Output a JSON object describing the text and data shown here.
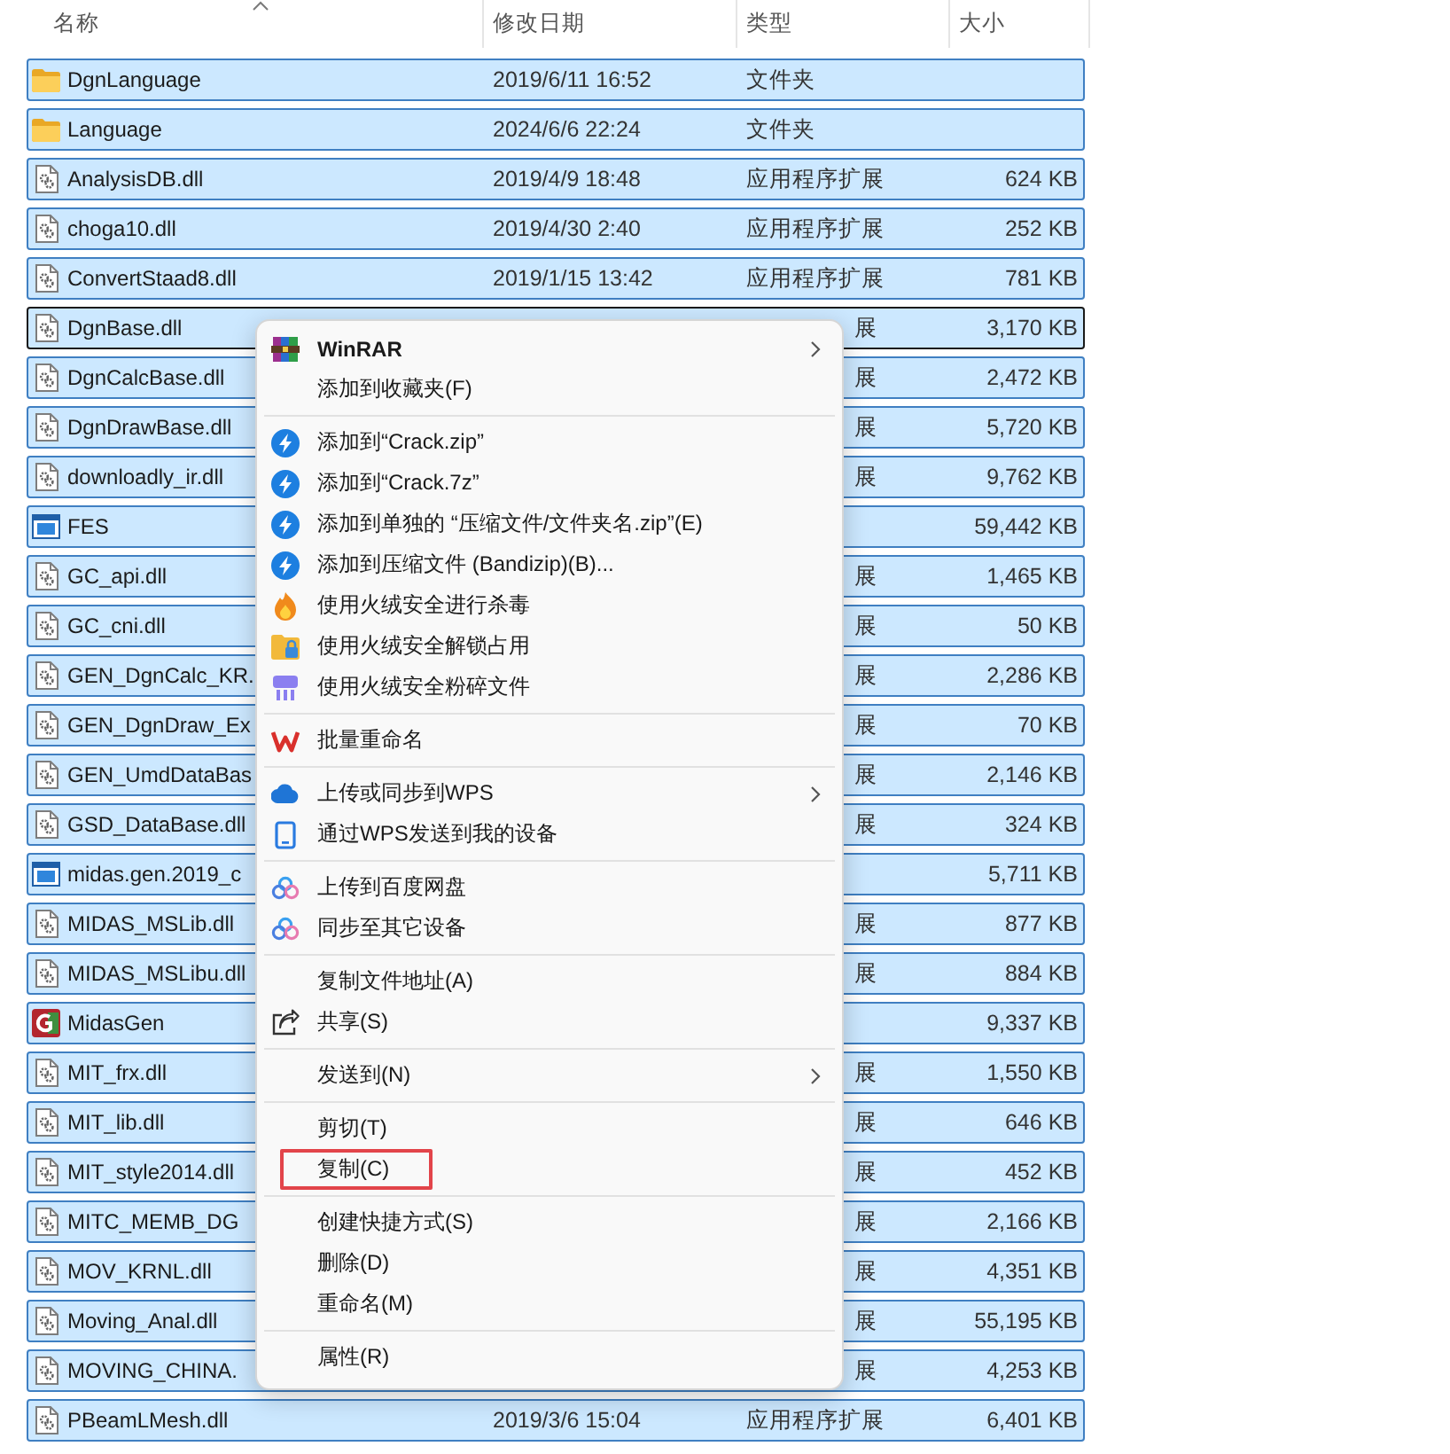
{
  "header": {
    "columns": [
      {
        "label": "名称",
        "sorted": true
      },
      {
        "label": "修改日期",
        "sorted": false
      },
      {
        "label": "类型",
        "sorted": false
      },
      {
        "label": "大小",
        "sorted": false
      }
    ]
  },
  "files": {
    "rows": [
      {
        "kind": "folder",
        "name": "DgnLanguage",
        "date": "2019/6/11 16:52",
        "type": "文件夹",
        "selected": true,
        "focused": false
      },
      {
        "kind": "folder",
        "name": "Language",
        "date": "2024/6/6 22:24",
        "type": "文件夹",
        "selected": true,
        "focused": false
      },
      {
        "kind": "library",
        "name": "AnalysisDB.dll",
        "date": "2019/4/9 18:48",
        "type": "应用程序扩展",
        "size": "624 KB",
        "selected": true,
        "focused": false
      },
      {
        "kind": "library",
        "name": "choga10.dll",
        "date": "2019/4/30 2:40",
        "type": "应用程序扩展",
        "size": "252 KB",
        "selected": true,
        "focused": false
      },
      {
        "kind": "library",
        "name": "ConvertStaad8.dll",
        "date": "2019/1/15 13:42",
        "type": "应用程序扩展",
        "size": "781 KB",
        "selected": true,
        "focused": false
      },
      {
        "kind": "library",
        "name": "DgnBase.dll",
        "type": "展",
        "size": "3,170 KB",
        "selected": true,
        "focused": true
      },
      {
        "kind": "library",
        "name": "DgnCalcBase.dll",
        "type": "展",
        "size": "2,472 KB",
        "selected": true,
        "focused": false
      },
      {
        "kind": "library",
        "name": "DgnDrawBase.dll",
        "type": "展",
        "size": "5,720 KB",
        "selected": true,
        "focused": false
      },
      {
        "kind": "library",
        "name": "downloadly_ir.dll",
        "type": "展",
        "size": "9,762 KB",
        "selected": true,
        "focused": false
      },
      {
        "kind": "program",
        "name": "FES",
        "size": "59,442 KB",
        "selected": true,
        "focused": false
      },
      {
        "kind": "library",
        "name": "GC_api.dll",
        "type": "展",
        "size": "1,465 KB",
        "selected": true,
        "focused": false
      },
      {
        "kind": "library",
        "name": "GC_cni.dll",
        "type": "展",
        "size": "50 KB",
        "selected": true,
        "focused": false
      },
      {
        "kind": "library",
        "name": "GEN_DgnCalc_KR.",
        "type": "展",
        "size": "2,286 KB",
        "selected": true,
        "focused": false
      },
      {
        "kind": "library",
        "name": "GEN_DgnDraw_Ex",
        "type": "展",
        "size": "70 KB",
        "selected": true,
        "focused": false
      },
      {
        "kind": "library",
        "name": "GEN_UmdDataBas",
        "type": "展",
        "size": "2,146 KB",
        "selected": true,
        "focused": false
      },
      {
        "kind": "library",
        "name": "GSD_DataBase.dll",
        "type": "展",
        "size": "324 KB",
        "selected": true,
        "focused": false
      },
      {
        "kind": "program",
        "name": "midas.gen.2019_c",
        "size": "5,711 KB",
        "selected": true,
        "focused": false
      },
      {
        "kind": "library",
        "name": "MIDAS_MSLib.dll",
        "type": "展",
        "size": "877 KB",
        "selected": true,
        "focused": false
      },
      {
        "kind": "library",
        "name": "MIDAS_MSLibu.dll",
        "type": "展",
        "size": "884 KB",
        "selected": true,
        "focused": false
      },
      {
        "kind": "app",
        "name": "MidasGen",
        "size": "9,337 KB",
        "selected": true,
        "focused": false
      },
      {
        "kind": "library",
        "name": "MIT_frx.dll",
        "type": "展",
        "size": "1,550 KB",
        "selected": true,
        "focused": false
      },
      {
        "kind": "library",
        "name": "MIT_lib.dll",
        "type": "展",
        "size": "646 KB",
        "selected": true,
        "focused": false
      },
      {
        "kind": "library",
        "name": "MIT_style2014.dll",
        "type": "展",
        "size": "452 KB",
        "selected": true,
        "focused": false
      },
      {
        "kind": "library",
        "name": "MITC_MEMB_DG",
        "type": "展",
        "size": "2,166 KB",
        "selected": true,
        "focused": false
      },
      {
        "kind": "library",
        "name": "MOV_KRNL.dll",
        "type": "展",
        "size": "4,351 KB",
        "selected": true,
        "focused": false
      },
      {
        "kind": "library",
        "name": "Moving_Anal.dll",
        "type": "展",
        "size": "55,195 KB",
        "selected": true,
        "focused": false
      },
      {
        "kind": "library",
        "name": "MOVING_CHINA.",
        "type": "展",
        "size": "4,253 KB",
        "selected": true,
        "focused": false
      },
      {
        "kind": "library",
        "name": "PBeamLMesh.dll",
        "date": "2019/3/6 15:04",
        "type": "应用程序扩展",
        "size": "6,401 KB",
        "selected": true,
        "focused": false
      }
    ]
  },
  "context_menu": {
    "groups": [
      [
        {
          "label": "WinRAR",
          "submenu": true,
          "highlighted": false
        },
        {
          "label": "添加到收藏夹(F)",
          "submenu": false,
          "highlighted": false
        }
      ],
      [
        {
          "label": "添加到“Crack.zip”",
          "submenu": false,
          "highlighted": false
        },
        {
          "label": "添加到“Crack.7z”",
          "submenu": false,
          "highlighted": false
        },
        {
          "label": "添加到单独的 “压缩文件/文件夹名.zip”(E)",
          "submenu": false,
          "highlighted": false
        },
        {
          "label": "添加到压缩文件 (Bandizip)(B)...",
          "submenu": false,
          "highlighted": false
        },
        {
          "label": "使用火绒安全进行杀毒",
          "submenu": false,
          "highlighted": false
        },
        {
          "label": "使用火绒安全解锁占用",
          "submenu": false,
          "highlighted": false
        },
        {
          "label": "使用火绒安全粉碎文件",
          "submenu": false,
          "highlighted": false
        }
      ],
      [
        {
          "label": "批量重命名",
          "submenu": false,
          "highlighted": false
        }
      ],
      [
        {
          "label": "上传或同步到WPS",
          "submenu": true,
          "highlighted": false
        },
        {
          "label": "通过WPS发送到我的设备",
          "submenu": false,
          "highlighted": false
        }
      ],
      [
        {
          "label": "上传到百度网盘",
          "submenu": false,
          "highlighted": false
        },
        {
          "label": "同步至其它设备",
          "submenu": false,
          "highlighted": false
        }
      ],
      [
        {
          "label": "复制文件地址(A)",
          "submenu": false,
          "highlighted": false
        },
        {
          "label": "共享(S)",
          "submenu": false,
          "highlighted": false
        }
      ],
      [
        {
          "label": "发送到(N)",
          "submenu": true,
          "highlighted": false
        }
      ],
      [
        {
          "label": "剪切(T)",
          "submenu": false,
          "highlighted": false
        },
        {
          "label": "复制(C)",
          "submenu": false,
          "highlighted": true
        }
      ],
      [
        {
          "label": "创建快捷方式(S)",
          "submenu": false,
          "highlighted": false
        },
        {
          "label": "删除(D)",
          "submenu": false,
          "highlighted": false
        },
        {
          "label": "重命名(M)",
          "submenu": false,
          "highlighted": false
        }
      ],
      [
        {
          "label": "属性(R)",
          "submenu": false,
          "highlighted": false
        }
      ]
    ]
  }
}
